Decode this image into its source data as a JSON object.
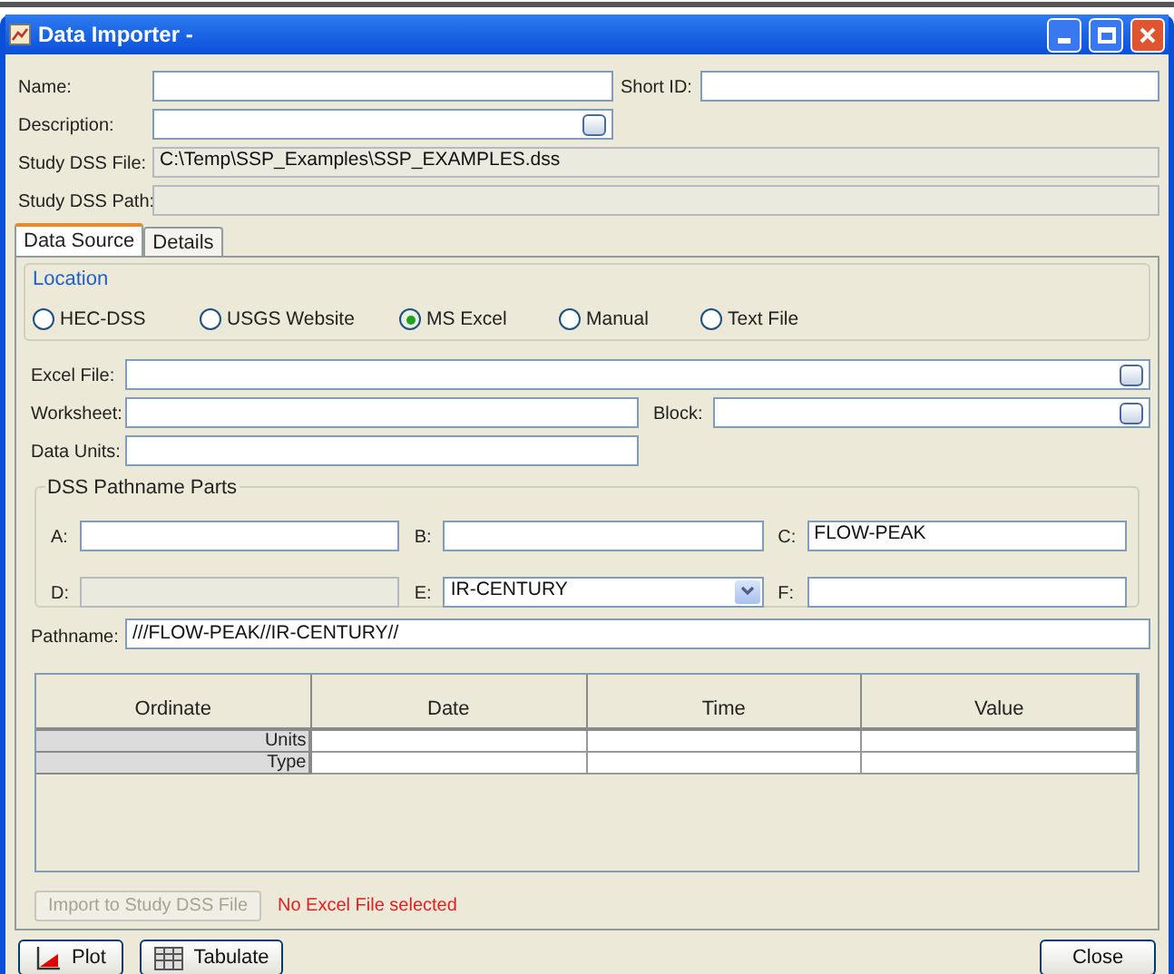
{
  "window": {
    "title": "Data Importer -"
  },
  "header": {
    "name": {
      "label": "Name:"
    },
    "short_id": {
      "label": "Short ID:"
    },
    "description": {
      "label": "Description:"
    },
    "study_dss_file": {
      "label": "Study DSS File:",
      "value": "C:\\Temp\\SSP_Examples\\SSP_EXAMPLES.dss"
    },
    "study_dss_path": {
      "label": "Study DSS Path:"
    }
  },
  "tabs": [
    {
      "label": "Data Source",
      "selected": true
    },
    {
      "label": "Details",
      "selected": false
    }
  ],
  "location": {
    "title": "Location",
    "options": [
      {
        "label": "HEC-DSS",
        "selected": false
      },
      {
        "label": "USGS Website",
        "selected": false
      },
      {
        "label": "MS Excel",
        "selected": true
      },
      {
        "label": "Manual",
        "selected": false
      },
      {
        "label": "Text File",
        "selected": false
      }
    ]
  },
  "excel_file": {
    "label": "Excel File:"
  },
  "worksheet": {
    "label": "Worksheet:"
  },
  "block": {
    "label": "Block:"
  },
  "data_units": {
    "label": "Data Units:"
  },
  "pathname_parts": {
    "title": "DSS Pathname Parts",
    "parts": [
      {
        "label": "A:",
        "kind": "text"
      },
      {
        "label": "B:",
        "kind": "text"
      },
      {
        "label": "C:",
        "value": "FLOW-PEAK",
        "kind": "text"
      },
      {
        "label": "D:",
        "kind": "disabled"
      },
      {
        "label": "E:",
        "value": "IR-CENTURY",
        "kind": "dropdown"
      },
      {
        "label": "F:",
        "kind": "text"
      }
    ]
  },
  "pathname": {
    "label": "Pathname:",
    "value": "///FLOW-PEAK//IR-CENTURY//"
  },
  "table": {
    "columns": [
      "Ordinate",
      "Date",
      "Time",
      "Value"
    ],
    "rows": [
      {
        "label": "Units"
      },
      {
        "label": "Type"
      }
    ]
  },
  "import_button": {
    "label": "Import to Study DSS File",
    "disabled": true
  },
  "status_message": "No Excel File selected",
  "footer_buttons": [
    {
      "label": "Plot",
      "kind": "plot"
    },
    {
      "label": "Tabulate",
      "kind": "tabulate"
    },
    {
      "label": "Close",
      "kind": "close"
    }
  ]
}
